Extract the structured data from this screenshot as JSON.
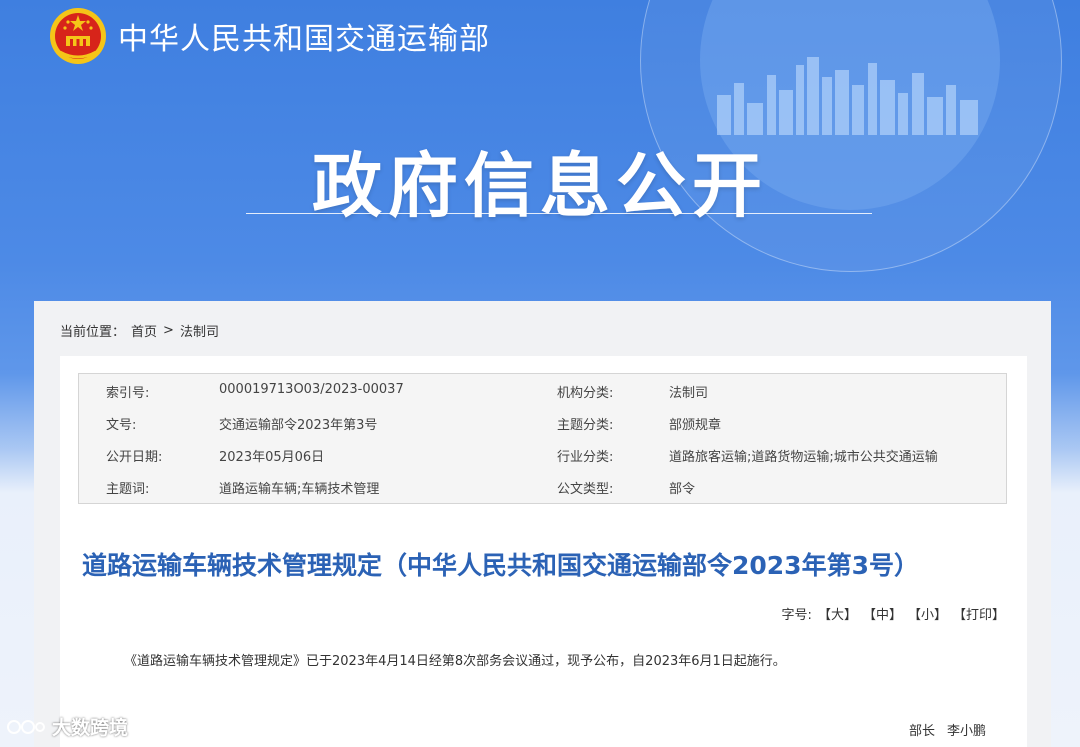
{
  "header": {
    "ministry_name": "中华人民共和国交通运输部",
    "section_title": "政府信息公开"
  },
  "breadcrumb": {
    "prefix": "当前位置：",
    "home": "首页",
    "separator": ">",
    "current": "法制司"
  },
  "meta": {
    "rows": [
      {
        "k1": "索引号:",
        "v1": "000019713O03/2023-00037",
        "k2": "机构分类:",
        "v2": "法制司"
      },
      {
        "k1": "文号:",
        "v1": "交通运输部令2023年第3号",
        "k2": "主题分类:",
        "v2": "部颁规章"
      },
      {
        "k1": "公开日期:",
        "v1": "2023年05月06日",
        "k2": "行业分类:",
        "v2": "道路旅客运输;道路货物运输;城市公共交通运输"
      },
      {
        "k1": "主题词:",
        "v1": "道路运输车辆;车辆技术管理",
        "k2": "公文类型:",
        "v2": "部令"
      }
    ]
  },
  "document": {
    "title": "道路运输车辆技术管理规定（中华人民共和国交通运输部令2023年第3号）",
    "font_label": "字号:",
    "font_large": "【大】",
    "font_medium": "【中】",
    "font_small": "【小】",
    "print": "【打印】",
    "paragraph": "《道路运输车辆技术管理规定》已于2023年4月14日经第8次部务会议通过，现予公布，自2023年6月1日起施行。",
    "signer_title": "部长",
    "signer_name": "李小鹏"
  },
  "watermark": {
    "text": "大数跨境"
  },
  "colors": {
    "banner_blue": "#4d8ae6",
    "title_blue": "#2b62b5",
    "emblem_red": "#d7241a",
    "emblem_gold": "#f5c518"
  }
}
